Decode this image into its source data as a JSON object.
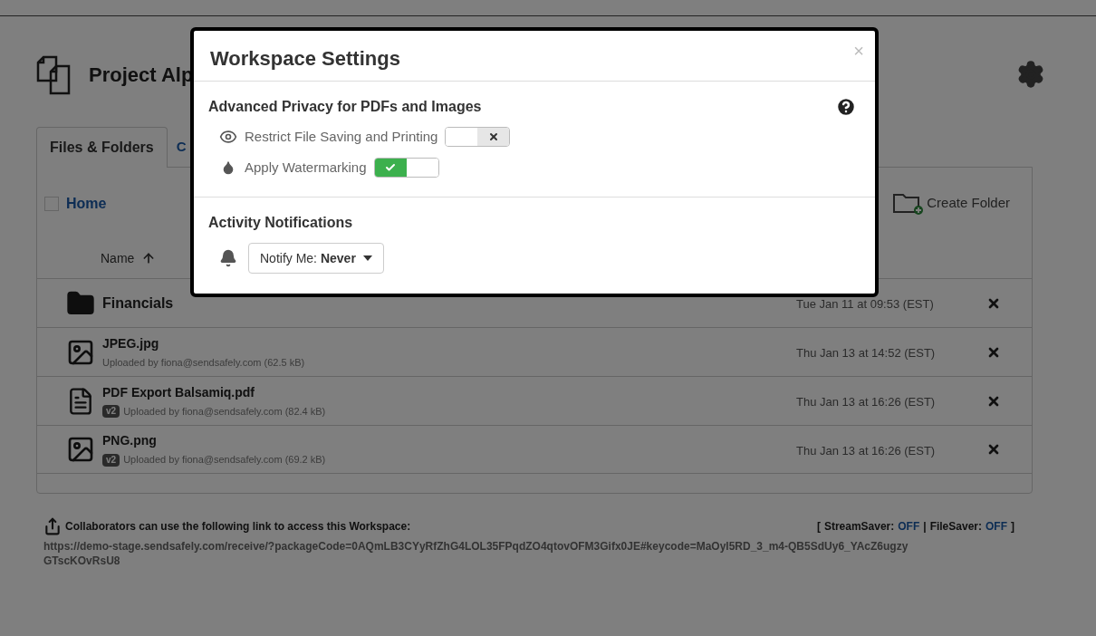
{
  "page": {
    "title": "Project Alp",
    "tabs": [
      {
        "label": "Files & Folders",
        "selected": true
      },
      {
        "label": "C",
        "selected": false
      }
    ],
    "breadcrumb": {
      "label": "Home",
      "checked": false
    },
    "create_folder": "Create Folder",
    "table": {
      "column": "Name",
      "rows": [
        {
          "kind": "folder",
          "name": "Financials",
          "date": "Tue Jan 11 at 09:53 (EST)"
        },
        {
          "kind": "image",
          "name": "JPEG.jpg",
          "detail": "Uploaded by fiona@sendsafely.com (62.5 kB)",
          "date": "Thu Jan 13 at 14:52 (EST)"
        },
        {
          "kind": "document",
          "name": "PDF Export Balsamiq.pdf",
          "version": "v2",
          "detail": "Uploaded by fiona@sendsafely.com (82.4 kB)",
          "date": "Thu Jan 13 at 16:26 (EST)"
        },
        {
          "kind": "image",
          "name": "PNG.png",
          "version": "v2",
          "detail": "Uploaded by fiona@sendsafely.com (69.2 kB)",
          "date": "Thu Jan 13 at 16:26 (EST)"
        }
      ]
    },
    "footer": {
      "message": "Collaborators can use the following link to access this Workspace:",
      "open": "[",
      "close": "]",
      "separator": "|",
      "savers": [
        {
          "label": "StreamSaver:",
          "value": "OFF"
        },
        {
          "label": "FileSaver:",
          "value": "OFF"
        }
      ],
      "link_lines": [
        "https://demo-stage.sendsafely.com/receive/?packageCode=0AQmLB3CYyRfZhG4LOL35FPqdZO4qtovOFM3Gifx0JE#keycode=MaOyl5RD_3_m4-QB5SdUy6_YAcZ6ugzy",
        "GTscKOvRsU8"
      ]
    }
  },
  "modal": {
    "title": "Workspace Settings",
    "close": "×",
    "privacy": {
      "title": "Advanced Privacy for PDFs and Images",
      "settings": [
        {
          "label": "Restrict File Saving and Printing",
          "on": false
        },
        {
          "label": "Apply Watermarking",
          "on": true
        }
      ]
    },
    "notifications": {
      "title": "Activity Notifications",
      "label": "Notify Me:",
      "value": "Never"
    }
  }
}
